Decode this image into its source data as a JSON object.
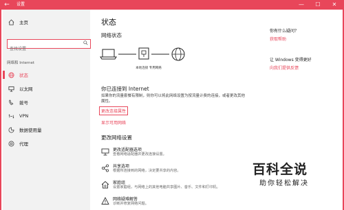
{
  "window": {
    "title": "设置",
    "back_glyph": "←",
    "minimize": "—",
    "maximize": "☐",
    "close": "✕"
  },
  "sidebar": {
    "home_label": "主页",
    "search_placeholder": "查找设置",
    "section_label": "网络和 Internet",
    "items": [
      {
        "label": "状态",
        "icon": "status-icon",
        "active": true
      },
      {
        "label": "以太网",
        "icon": "ethernet-icon",
        "active": false
      },
      {
        "label": "拨号",
        "icon": "dialup-icon",
        "active": false
      },
      {
        "label": "VPN",
        "icon": "vpn-icon",
        "active": false
      },
      {
        "label": "数据使用量",
        "icon": "data-usage-icon",
        "active": false
      },
      {
        "label": "代理",
        "icon": "proxy-icon",
        "active": false
      }
    ]
  },
  "main": {
    "title": "状态",
    "net_status_heading": "网络状态",
    "diagram_caption": "本地连接 专用网络",
    "connected_title": "你已连接到 Internet",
    "connected_desc": "如果你的流量套餐有限制，则你可以将此网络设置为按流量计费的连接，或者更改其他属性。",
    "change_props_link": "更改连接属性",
    "show_networks_link": "显示可用网络",
    "change_heading": "更改网络设置",
    "options": [
      {
        "title": "更改适配器选项",
        "desc": "查看网络适配器并更改连接设置。",
        "icon": "adapter-icon"
      },
      {
        "title": "共享选项",
        "desc": "根据所连接到的网络，决定要共享的内容。",
        "icon": "sharing-icon"
      },
      {
        "title": "家庭组",
        "desc": "设置家庭组，与网络上的其他电脑共享图片、音乐、文件和打印机。",
        "icon": "homegroup-icon"
      },
      {
        "title": "网络疑难解答",
        "desc": "诊断并修复网络问题。",
        "icon": "troubleshoot-icon"
      }
    ]
  },
  "right": {
    "help_question": "你有什么疑问？",
    "help_link": "获取帮助",
    "better_question": "让 Windows 变得更好",
    "feedback_link": "向我们提供反馈"
  },
  "watermark": {
    "main": "百科全说",
    "sub": "助你轻松解决"
  },
  "colors": {
    "accent": "#e8465a"
  }
}
